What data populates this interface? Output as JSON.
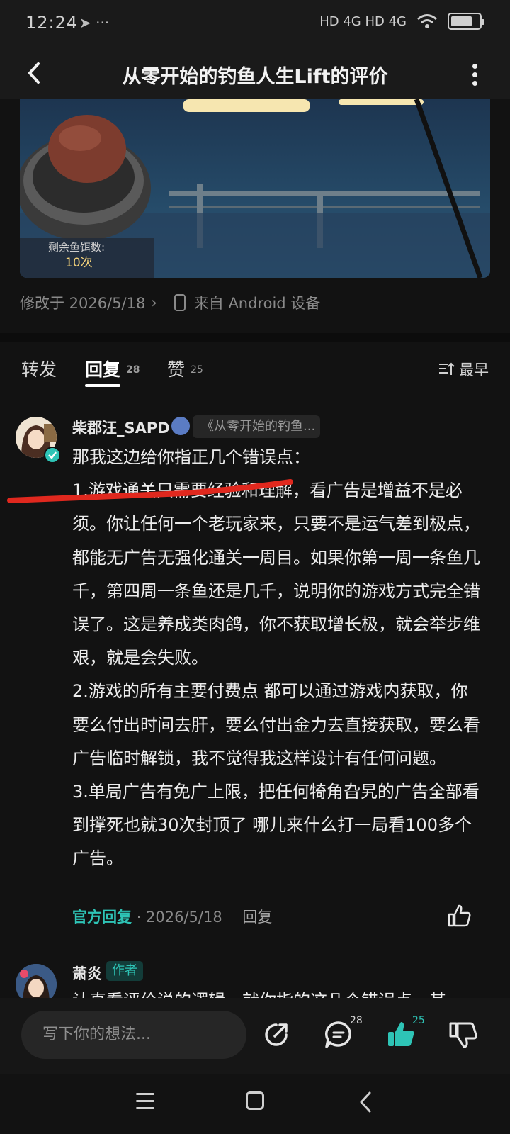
{
  "status_bar": {
    "time": "12:24",
    "left_icons": "➤ ···",
    "network": "HD 4G HD 4G",
    "battery_percent": 75
  },
  "header": {
    "title": "从零开始的钓鱼人生Lift的评价"
  },
  "image": {
    "bait_label": "剩余鱼饵数:",
    "bait_count": "10次"
  },
  "meta": {
    "modified": "修改于 2026/5/18",
    "source": "来自 Android 设备"
  },
  "tabs": [
    {
      "label": "转发",
      "count": ""
    },
    {
      "label": "回复",
      "count": "28"
    },
    {
      "label": "赞",
      "count": "25"
    }
  ],
  "sort_label": "最早",
  "comment": {
    "user": "柴郡汪_SAPD",
    "ref": "《从零开始的钓鱼...",
    "paragraphs": [
      "那我这边给你指正几个错误点：",
      "1.游戏通关只需要经验和理解，看广告是增益不是必须。你让任何一个老玩家来，只要不是运气差到极点，都能无广告无强化通关一周目。如果你第一周一条鱼几千，第四周一条鱼还是几千，说明你的游戏方式完全错误了。这是养成类肉鸽，你不获取增长极，就会举步维艰，就是会失败。",
      "2.游戏的所有主要付费点 都可以通过游戏内获取，你要么付出时间去肝，要么付出金力去直接获取，要么看广告临时解锁，我不觉得我这样设计有任何问题。",
      "3.单局广告有免广上限，把任何犄角旮旯的广告全部看到撑死也就30次封顶了 哪儿来什么打一局看100多个广告。"
    ],
    "official_label": "官方回复",
    "date": "· 2026/5/18",
    "reply_label": "回复"
  },
  "reply": {
    "user": "萧炎",
    "tag": "作者",
    "text": "认真看评价说的逻辑，就你指的这几个错误点，其"
  },
  "bottom_bar": {
    "placeholder": "写下你的想法...",
    "comment_count": "28",
    "like_count": "25"
  },
  "colors": {
    "accent": "#2ec4b6",
    "background": "#121212",
    "annotation_red": "#e0281e"
  }
}
